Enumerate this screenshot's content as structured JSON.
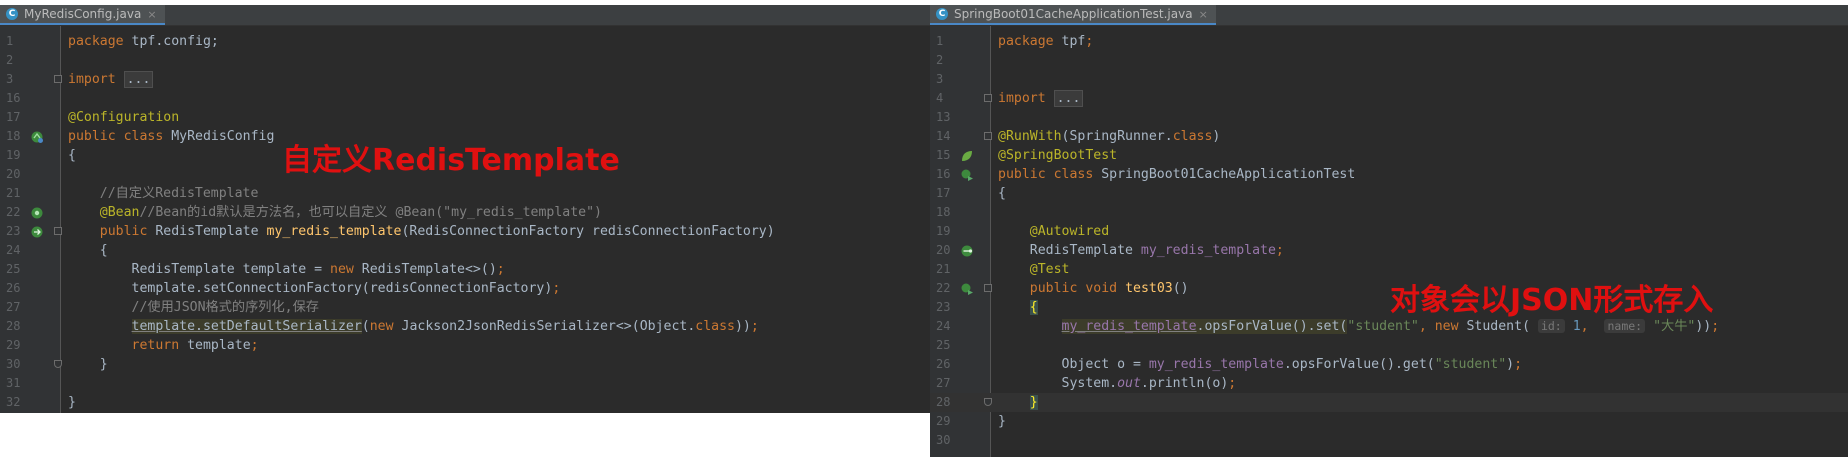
{
  "left": {
    "tab": {
      "label": "MyRedisConfig.java",
      "icon": "C",
      "close": "×"
    },
    "annotation": "自定义RedisTemplate",
    "lines": [
      {
        "n": "1",
        "html": "<span class=\"kw\">package</span> tpf.config;"
      },
      {
        "n": "2",
        "html": ""
      },
      {
        "n": "3",
        "html": "<span class=\"kw\">import</span> <span class=\"fold-box\">...</span>",
        "fold": "start"
      },
      {
        "n": "16",
        "html": ""
      },
      {
        "n": "17",
        "html": "<span class=\"ann\">@Configuration</span>"
      },
      {
        "n": "18",
        "html": "<span class=\"kw\">public class</span> MyRedisConfig",
        "marker": "bean-config-icon"
      },
      {
        "n": "19",
        "html": "{"
      },
      {
        "n": "20",
        "html": ""
      },
      {
        "n": "21",
        "html": "    <span class=\"cmt\">//自定义RedisTemplate</span>"
      },
      {
        "n": "22",
        "html": "    <span class=\"ann\">@Bean</span><span class=\"cmt\">//Bean的id默认是方法名，也可以自定义 @Bean(\"my_redis_template\")</span>",
        "marker": "bean-icon"
      },
      {
        "n": "23",
        "html": "    <span class=\"kw\">public</span> RedisTemplate <span class=\"fn\">my_redis_template</span>(RedisConnectionFactory redisConnectionFactory)",
        "marker": "bean-injection-icon",
        "fold": "start"
      },
      {
        "n": "24",
        "html": "    {"
      },
      {
        "n": "25",
        "html": "        RedisTemplate template = <span class=\"kw\">new</span> RedisTemplate&lt;&gt;()<span class=\"kw\">;</span>"
      },
      {
        "n": "26",
        "html": "        template.setConnectionFactory(redisConnectionFactory)<span class=\"kw\">;</span>"
      },
      {
        "n": "27",
        "html": "        <span class=\"cmt\">//使用JSON格式的序列化,保存</span>"
      },
      {
        "n": "28",
        "html": "        <span class=\"hl ul\">template.setDefaultSerializer</span>(<span class=\"kw\">new</span> Jackson2JsonRedisSerializer&lt;&gt;(Object.<span class=\"kw\">class</span>))<span class=\"kw\">;</span>"
      },
      {
        "n": "29",
        "html": "        <span class=\"kw\">return</span> template<span class=\"kw\">;</span>"
      },
      {
        "n": "30",
        "html": "    }",
        "fold": "end"
      },
      {
        "n": "31",
        "html": ""
      },
      {
        "n": "32",
        "html": "}"
      }
    ]
  },
  "right": {
    "tab": {
      "label": "SpringBoot01CacheApplicationTest.java",
      "icon": "C",
      "close": "×"
    },
    "annotation": "对象会以JSON形式存入",
    "lines": [
      {
        "n": "1",
        "html": "<span class=\"kw\">package</span> tpf<span class=\"kw\">;</span>"
      },
      {
        "n": "2",
        "html": ""
      },
      {
        "n": "3",
        "html": ""
      },
      {
        "n": "4",
        "html": "<span class=\"kw\">import</span> <span class=\"fold-box\">...</span>",
        "fold": "start"
      },
      {
        "n": "13",
        "html": ""
      },
      {
        "n": "14",
        "html": "<span class=\"ann\">@RunWith</span>(SpringRunner.<span class=\"kw\">class</span>)",
        "fold": "start"
      },
      {
        "n": "15",
        "html": "<span class=\"ann\">@SpringBootTest</span>",
        "marker": "spring-leaf-icon"
      },
      {
        "n": "16",
        "html": "<span class=\"kw\">public class</span> SpringBoot01CacheApplicationTest",
        "marker": "run-test-icon"
      },
      {
        "n": "17",
        "html": "{"
      },
      {
        "n": "18",
        "html": ""
      },
      {
        "n": "19",
        "html": "    <span class=\"ann\">@Autowired</span>"
      },
      {
        "n": "20",
        "html": "    RedisTemplate <span class=\"fld\">my_redis_template</span><span class=\"kw\">;</span>",
        "marker": "autowired-icon"
      },
      {
        "n": "21",
        "html": "    <span class=\"ann\">@Test</span>"
      },
      {
        "n": "22",
        "html": "    <span class=\"kw\">public void</span> <span class=\"fn\">test03</span>()",
        "marker": "run-test-icon",
        "fold": "start"
      },
      {
        "n": "23",
        "html": "    <span class=\"brace-hl\">{</span>"
      },
      {
        "n": "24",
        "html": "        <span class=\"hl\"><span class=\"fld ul\">my_redis_template</span>.opsForValue().set(</span><span class=\"str\">\"student\"</span><span class=\"kw\">, new</span> Student( <span class=\"hint\">id:</span> <span class=\"num\">1</span><span class=\"kw\">,</span>  <span class=\"hint\">name:</span> <span class=\"str\">\"大牛\"</span>))<span class=\"kw\">;</span>"
      },
      {
        "n": "25",
        "html": ""
      },
      {
        "n": "26",
        "html": "        Object o = <span class=\"fld\">my_redis_template</span>.opsForValue().get(<span class=\"str\">\"student\"</span>)<span class=\"kw\">;</span>"
      },
      {
        "n": "27",
        "html": "        System.<span class=\"fld it\">out</span>.println(o)<span class=\"kw\">;</span>"
      },
      {
        "n": "28",
        "html": "    <span class=\"brace-hl\">}</span>",
        "fold": "end",
        "current": true
      },
      {
        "n": "29",
        "html": "}"
      },
      {
        "n": "30",
        "html": ""
      }
    ]
  }
}
